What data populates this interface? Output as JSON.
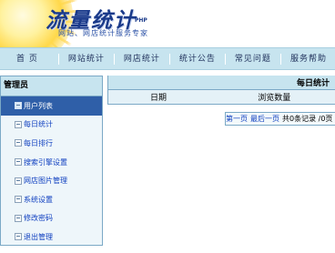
{
  "header": {
    "logo_text": "流量统计",
    "logo_php": "PHP",
    "logo_subtitle": "网站、网店统计服务专家"
  },
  "nav": {
    "items": [
      "首 页",
      "网站统计",
      "网店统计",
      "统计公告",
      "常见问题",
      "服务帮助"
    ]
  },
  "sidebar": {
    "title": "管理员",
    "items": [
      {
        "label": "用户列表",
        "active": true
      },
      {
        "label": "每日统计"
      },
      {
        "label": "每日排行"
      },
      {
        "label": "搜索引擎设置"
      },
      {
        "label": "网店图片管理"
      },
      {
        "label": "系统设置"
      },
      {
        "label": "修改密码"
      },
      {
        "label": "退出管理"
      }
    ]
  },
  "main": {
    "table_title": "每日统计",
    "columns": [
      "日期",
      "浏览数量"
    ],
    "pager": {
      "first": "第一页",
      "last": "最后一页",
      "total_text": "共0条记录 /0页"
    }
  },
  "colors": {
    "nav_bg": "#c7e4ef",
    "active_menu_bg": "#2f5fa8",
    "link": "#1040c0",
    "border": "#7ba9c6"
  }
}
